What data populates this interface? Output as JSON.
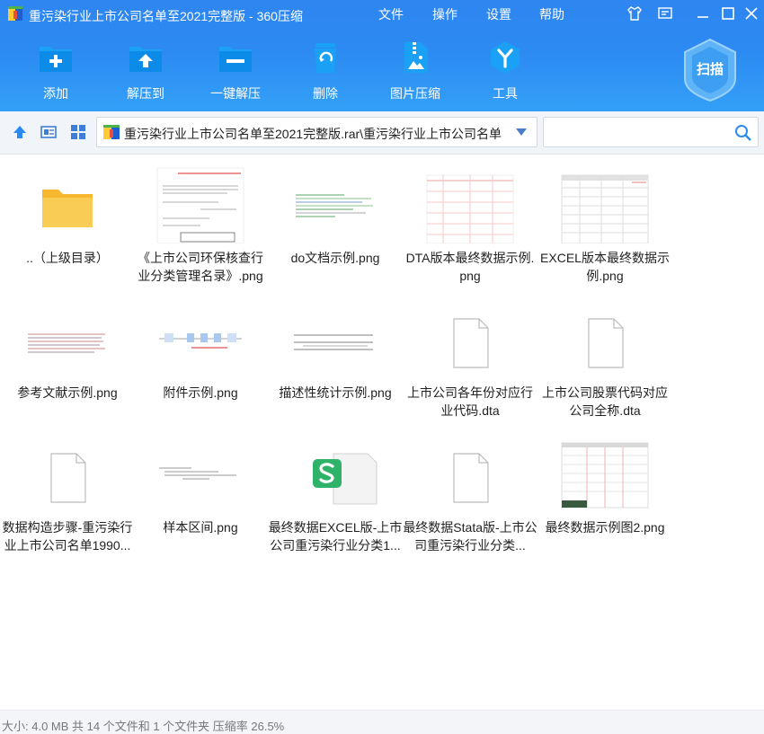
{
  "window": {
    "title": "重污染行业上市公司名单至2021完整版 - 360压缩",
    "menu": [
      "文件",
      "操作",
      "设置",
      "帮助"
    ],
    "controls": [
      "shirt-icon",
      "feedback-icon",
      "minimize-icon",
      "maximize-icon",
      "close-icon"
    ]
  },
  "toolbar": {
    "buttons": [
      {
        "label": "添加",
        "icon": "add-icon"
      },
      {
        "label": "解压到",
        "icon": "extract-to-icon"
      },
      {
        "label": "一键解压",
        "icon": "one-click-extract-icon"
      },
      {
        "label": "删除",
        "icon": "delete-icon"
      },
      {
        "label": "图片压缩",
        "icon": "image-compress-icon"
      },
      {
        "label": "工具",
        "icon": "tools-icon"
      }
    ],
    "scan_label": "扫描"
  },
  "pathbar": {
    "path": "重污染行业上市公司名单至2021完整版.rar\\重污染行业上市公司名单",
    "search_placeholder": ""
  },
  "files": [
    {
      "name": "..（上级目录）",
      "kind": "folder"
    },
    {
      "name": "《上市公司环保核查行业分类管理名录》.png",
      "kind": "png-doc"
    },
    {
      "name": "do文档示例.png",
      "kind": "png-code"
    },
    {
      "name": "DTA版本最终数据示例.png",
      "kind": "png-table"
    },
    {
      "name": "EXCEL版本最终数据示例.png",
      "kind": "png-excel"
    },
    {
      "name": "参考文献示例.png",
      "kind": "png-refs"
    },
    {
      "name": "附件示例.png",
      "kind": "png-flow"
    },
    {
      "name": "描述性统计示例.png",
      "kind": "png-stats"
    },
    {
      "name": "上市公司各年份对应行业代码.dta",
      "kind": "blank"
    },
    {
      "name": "上市公司股票代码对应公司全称.dta",
      "kind": "blank"
    },
    {
      "name": "数据构造步骤-重污染行业上市公司名单1990...",
      "kind": "blank"
    },
    {
      "name": "样本区间.png",
      "kind": "png-sample"
    },
    {
      "name": "最终数据EXCEL版-上市公司重污染行业分类1...",
      "kind": "xls"
    },
    {
      "name": "最终数据Stata版-上市公司重污染行业分类...",
      "kind": "blank"
    },
    {
      "name": "最终数据示例图2.png",
      "kind": "png-excel2"
    }
  ],
  "status": {
    "text": "大小: 4.0 MB 共 14 个文件和 1 个文件夹 压缩率 26.5%"
  },
  "colors": {
    "toolbar_blue": "#2f86f0",
    "icon_blue": "#1aa1f5",
    "folder_yellow": "#f7c342",
    "xls_green": "#2fb36a"
  }
}
